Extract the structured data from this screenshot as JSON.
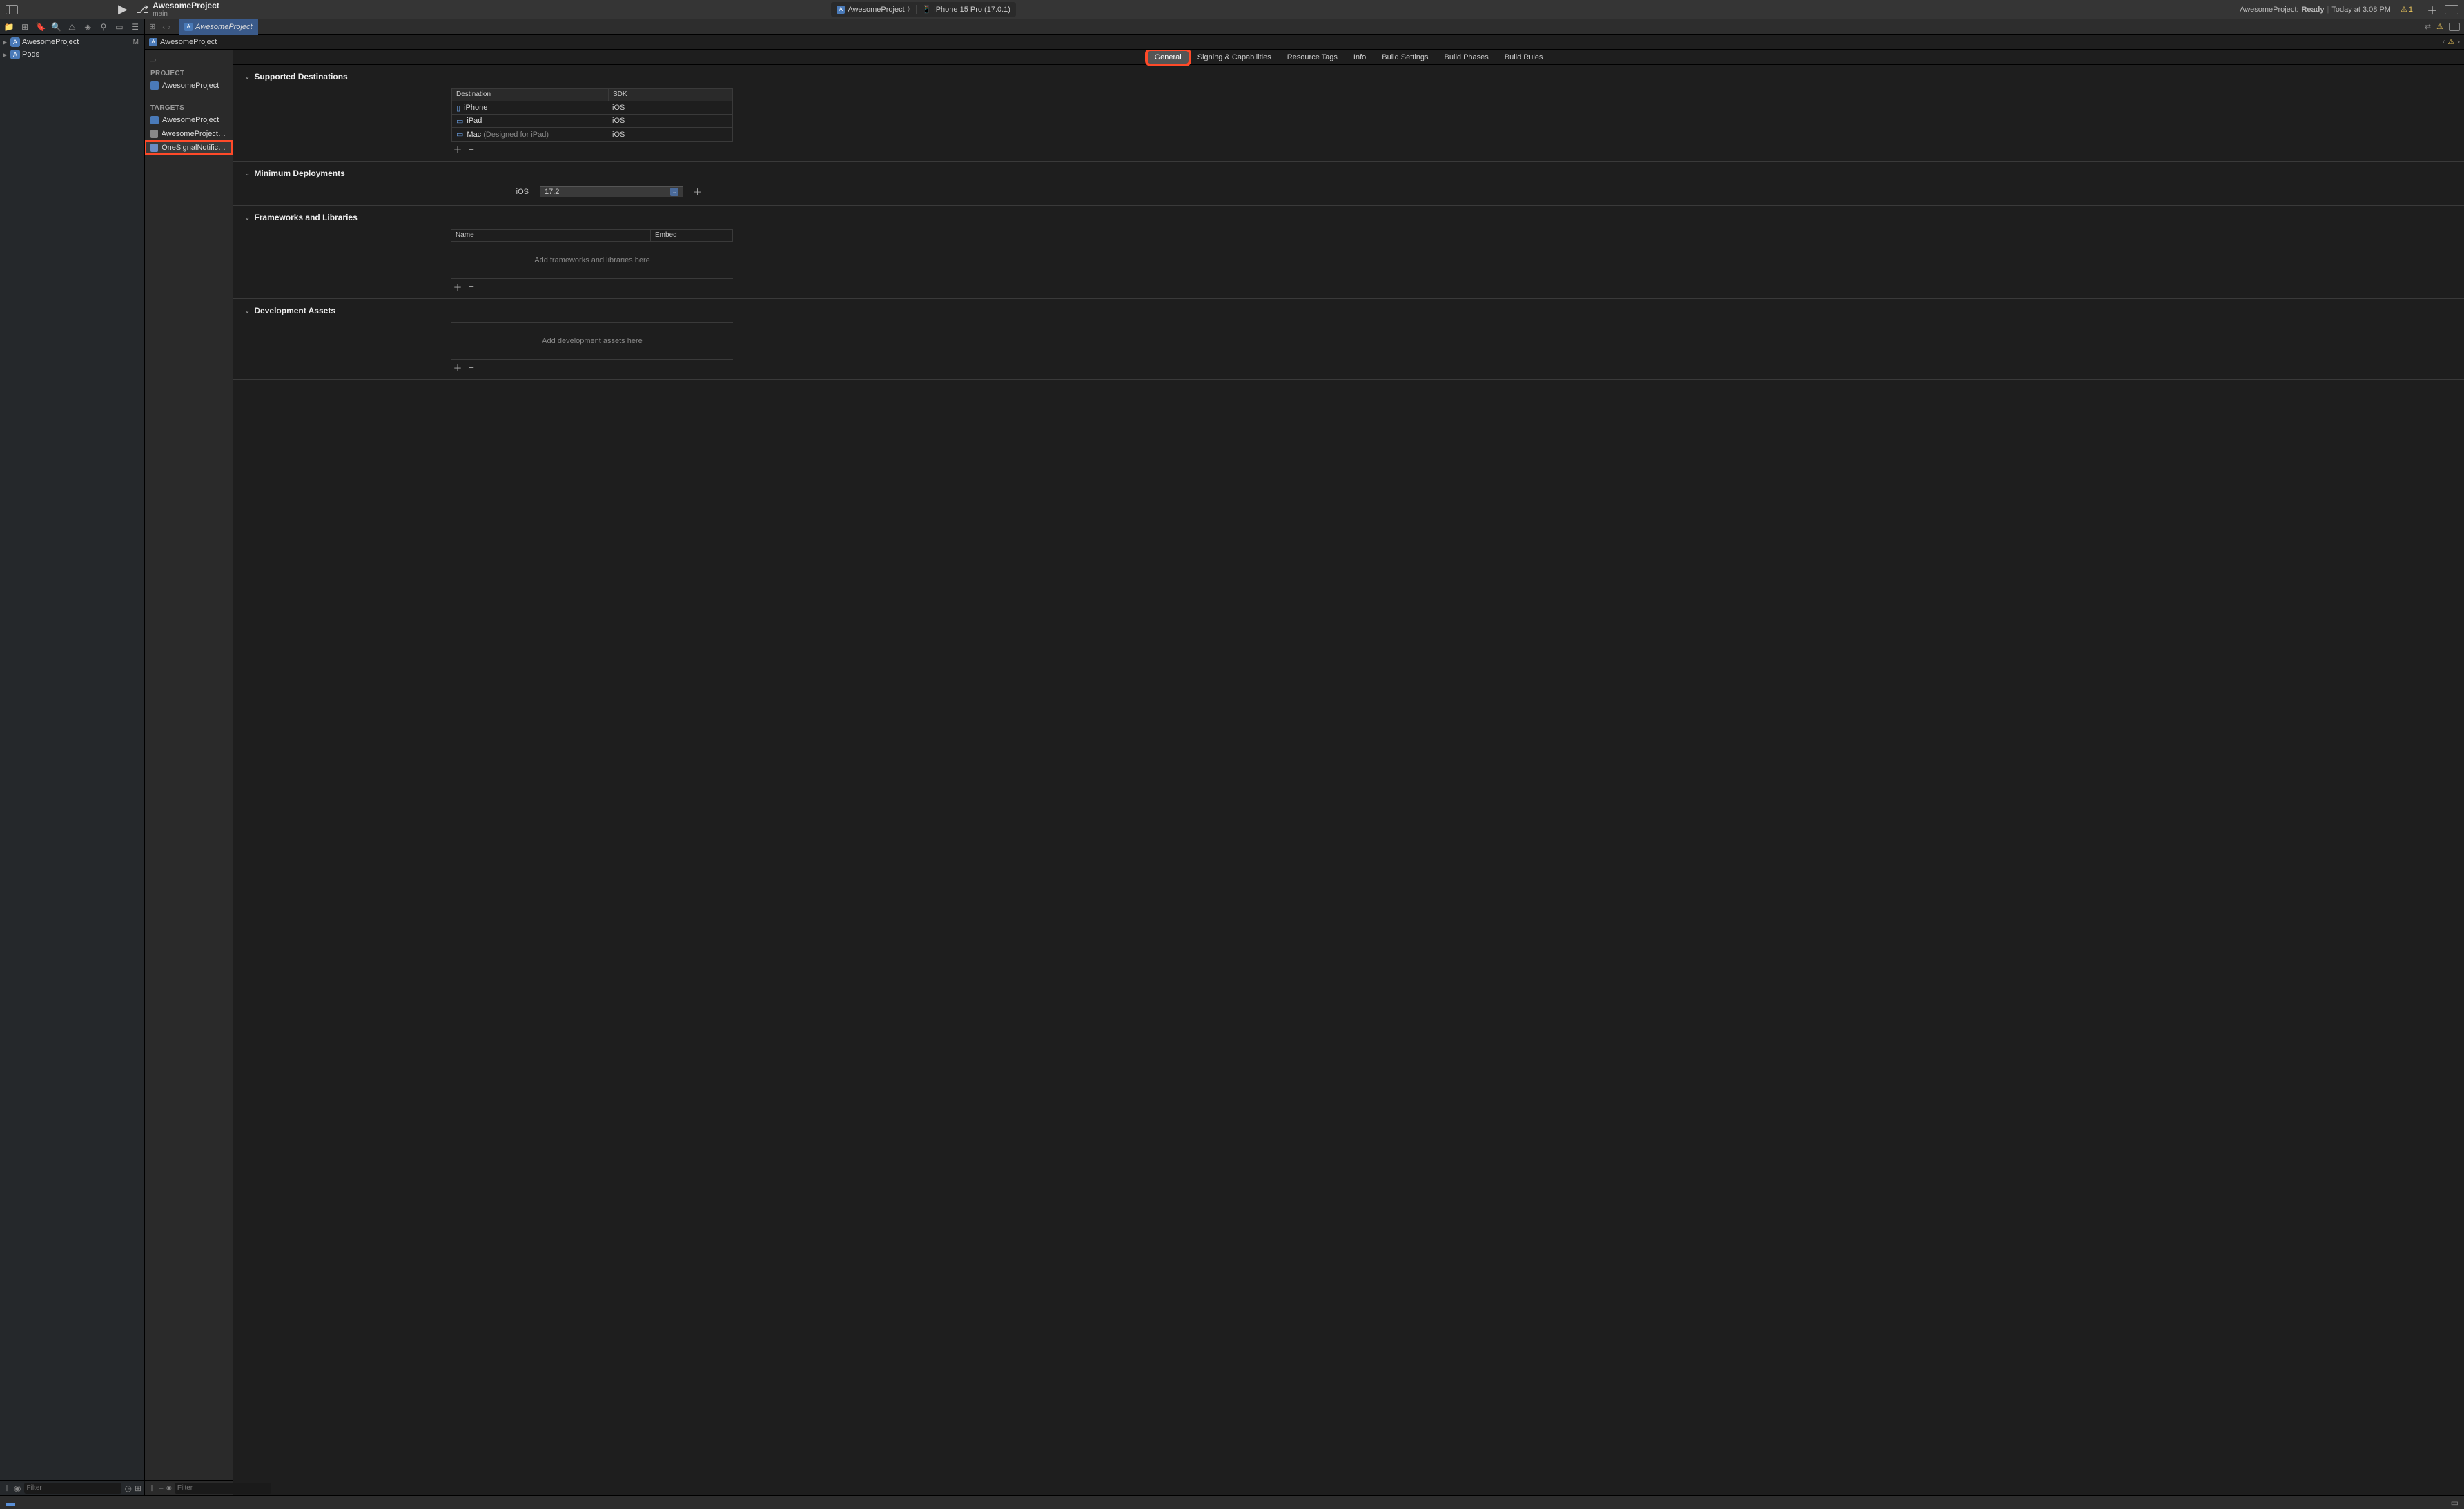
{
  "toolbar": {
    "project_name": "AwesomeProject",
    "branch": "main",
    "scheme_name": "AwesomeProject",
    "scheme_chevron": "⟩",
    "device": "iPhone 15 Pro (17.0.1)",
    "status_prefix": "AwesomeProject:",
    "status_ready": "Ready",
    "status_divider": "|",
    "status_time": "Today at 3:08 PM",
    "warning_count": "1"
  },
  "sidebar": {
    "items": [
      {
        "label": "AwesomeProject",
        "status": "M"
      },
      {
        "label": "Pods",
        "status": ""
      }
    ],
    "filter_placeholder": "Filter"
  },
  "breadcrumb": {
    "tab_label": "AwesomeProject",
    "path_label": "AwesomeProject"
  },
  "sub_sidebar": {
    "project_header": "PROJECT",
    "project_item": "AwesomeProject",
    "targets_header": "TARGETS",
    "targets": [
      {
        "label": "AwesomeProject",
        "type": "app"
      },
      {
        "label": "AwesomeProjectTests",
        "type": "test"
      },
      {
        "label": "OneSignalNotificati...",
        "type": "ext"
      }
    ],
    "filter_placeholder": "Filter"
  },
  "tabs": [
    "General",
    "Signing & Capabilities",
    "Resource Tags",
    "Info",
    "Build Settings",
    "Build Phases",
    "Build Rules"
  ],
  "sections": {
    "supported_dest": {
      "title": "Supported Destinations",
      "col1": "Destination",
      "col2": "SDK",
      "rows": [
        {
          "name": "iPhone",
          "sdk": "iOS",
          "icon": "📱"
        },
        {
          "name": "iPad",
          "sdk": "iOS",
          "icon": "▭"
        },
        {
          "name": "Mac",
          "suffix": "(Designed for iPad)",
          "sdk": "iOS",
          "icon": "💻"
        }
      ]
    },
    "min_deploy": {
      "title": "Minimum Deployments",
      "label": "iOS",
      "value": "17.2"
    },
    "frameworks": {
      "title": "Frameworks and Libraries",
      "col1": "Name",
      "col2": "Embed",
      "empty": "Add frameworks and libraries here"
    },
    "dev_assets": {
      "title": "Development Assets",
      "empty": "Add development assets here"
    }
  }
}
